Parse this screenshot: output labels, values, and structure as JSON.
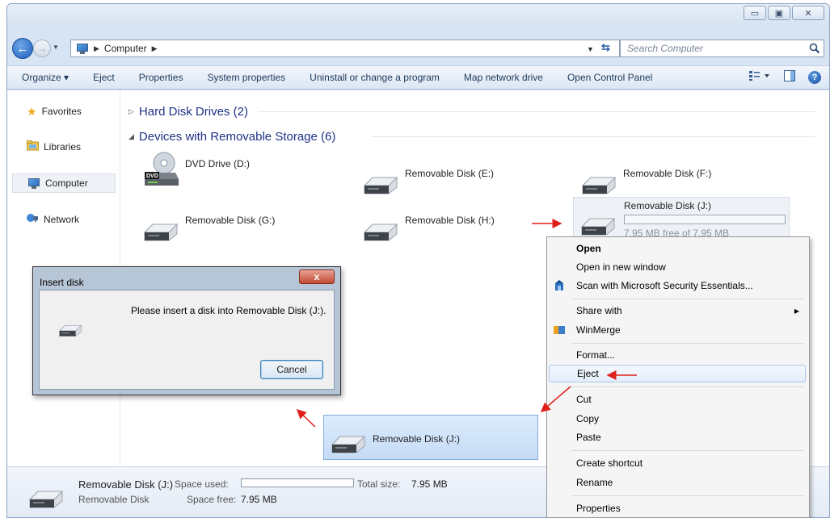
{
  "window": {
    "minimize_label": "▭",
    "maximize_label": "▣",
    "close_label": "✕"
  },
  "address": {
    "path_root": "Computer",
    "search_placeholder": "Search Computer"
  },
  "toolbar": {
    "organize": "Organize ▾",
    "eject": "Eject",
    "properties": "Properties",
    "system_properties": "System properties",
    "uninstall": "Uninstall or change a program",
    "map_drive": "Map network drive",
    "control_panel": "Open Control Panel"
  },
  "nav": {
    "favorites": "Favorites",
    "libraries": "Libraries",
    "computer": "Computer",
    "network": "Network"
  },
  "groups": {
    "hdd": "Hard Disk Drives (2)",
    "removable": "Devices with Removable Storage (6)"
  },
  "drives": {
    "dvd": "DVD Drive (D:)",
    "e": "Removable Disk (E:)",
    "f": "Removable Disk (F:)",
    "g": "Removable Disk (G:)",
    "h": "Removable Disk (H:)",
    "j": "Removable Disk (J:)",
    "j_free": "7.95 MB free of 7.95 MB",
    "dvd_badge": "DVD"
  },
  "drag_tile": {
    "label": "Removable Disk (J:)"
  },
  "dialog": {
    "title": "Insert disk",
    "message": "Please insert a disk into Removable Disk (J:).",
    "cancel": "Cancel",
    "close": "x"
  },
  "context_menu": {
    "open": "Open",
    "open_new_window": "Open in new window",
    "scan": "Scan with Microsoft Security Essentials...",
    "share_with": "Share with",
    "winmerge": "WinMerge",
    "format": "Format...",
    "eject": "Eject",
    "cut": "Cut",
    "copy": "Copy",
    "paste": "Paste",
    "create_shortcut": "Create shortcut",
    "rename": "Rename",
    "properties": "Properties"
  },
  "details": {
    "name": "Removable Disk (J:)",
    "type": "Removable Disk",
    "space_used_label": "Space used:",
    "space_free_label": "Space free:",
    "space_free_value": "7.95 MB",
    "total_size_label": "Total size:",
    "total_size_value": "7.95 MB"
  },
  "colors": {
    "accent": "#1e3287",
    "annotation_arrow": "#e0201b"
  }
}
